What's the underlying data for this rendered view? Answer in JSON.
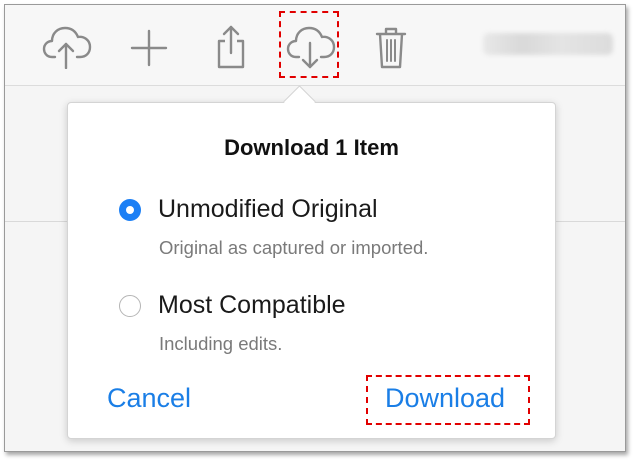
{
  "toolbar": {
    "buttons": [
      {
        "name": "upload-cloud-icon"
      },
      {
        "name": "add-icon"
      },
      {
        "name": "share-icon"
      },
      {
        "name": "download-cloud-icon"
      },
      {
        "name": "trash-icon"
      }
    ]
  },
  "dialog": {
    "title": "Download 1 Item",
    "options": [
      {
        "label": "Unmodified Original",
        "description": "Original as captured or imported.",
        "selected": true
      },
      {
        "label": "Most Compatible",
        "description": "Including edits.",
        "selected": false
      }
    ],
    "cancel_label": "Cancel",
    "download_label": "Download"
  },
  "colors": {
    "accent": "#1b7ff5",
    "highlight": "#e10000"
  }
}
